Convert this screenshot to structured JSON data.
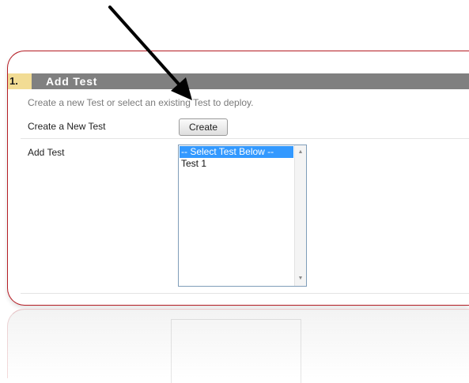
{
  "step": {
    "number": "1.",
    "title": "Add Test",
    "instructions": "Create a new Test or select an existing Test to deploy."
  },
  "create_row": {
    "label": "Create a New Test",
    "button_label": "Create"
  },
  "add_row": {
    "label": "Add Test",
    "options": [
      "-- Select Test Below --",
      "Test 1"
    ],
    "selected_option": "-- Select Test Below --"
  },
  "colors": {
    "header_bar": "#808080",
    "step_number_bg": "#f2dc94",
    "frame_border": "#b51c24",
    "selected_option_bg": "#3399ff",
    "arrow": "#000000"
  },
  "icons": {
    "scroll_up": "scroll-up-arrow-icon",
    "scroll_down": "scroll-down-arrow-icon",
    "annotation": "annotation-arrow-icon"
  }
}
